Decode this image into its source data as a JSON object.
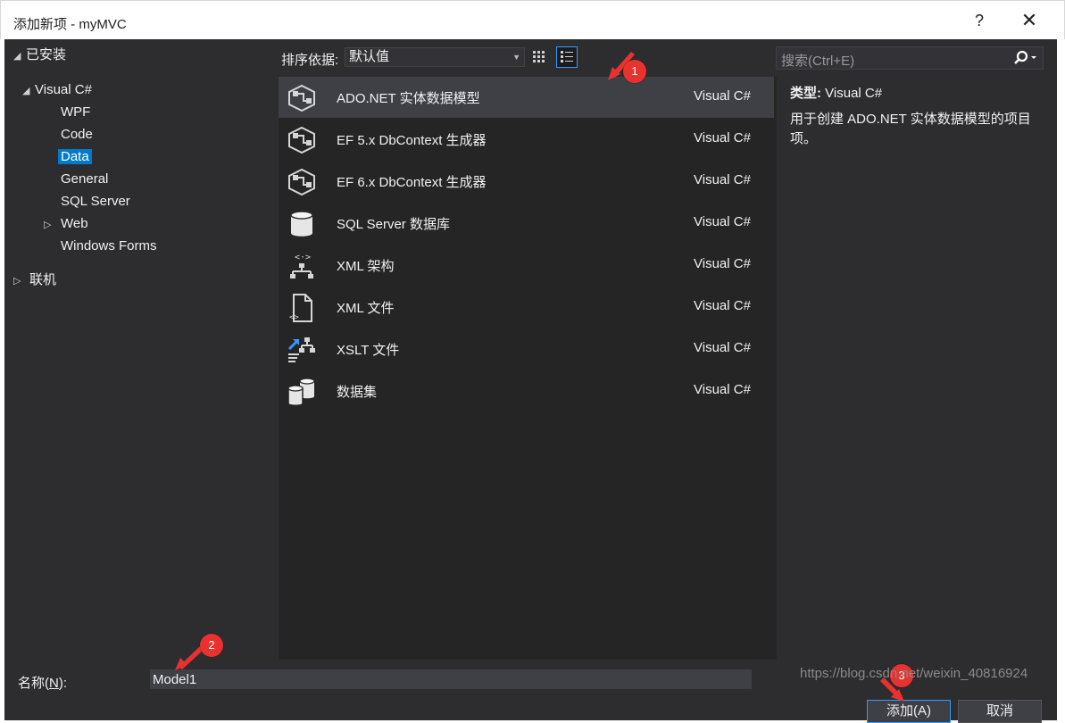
{
  "window": {
    "title": "添加新项 - myMVC",
    "help_label": "?",
    "close_label": "✕"
  },
  "tree": {
    "installed": "已安装",
    "visual_csharp": "Visual C#",
    "children": [
      "WPF",
      "Code",
      "Data",
      "General",
      "SQL Server",
      "Web",
      "Windows Forms"
    ],
    "selected": "Data",
    "online": "联机"
  },
  "toolbar": {
    "sort_label": "排序依据:",
    "sort_value": "默认值"
  },
  "search": {
    "placeholder": "搜索(Ctrl+E)"
  },
  "items": [
    {
      "name": "ADO.NET 实体数据模型",
      "lang": "Visual C#",
      "icon": "ado-net-model-icon"
    },
    {
      "name": "EF 5.x DbContext 生成器",
      "lang": "Visual C#",
      "icon": "ef5-generator-icon"
    },
    {
      "name": "EF 6.x DbContext 生成器",
      "lang": "Visual C#",
      "icon": "ef6-generator-icon"
    },
    {
      "name": "SQL Server 数据库",
      "lang": "Visual C#",
      "icon": "database-icon"
    },
    {
      "name": "XML 架构",
      "lang": "Visual C#",
      "icon": "xml-schema-icon"
    },
    {
      "name": "XML 文件",
      "lang": "Visual C#",
      "icon": "xml-file-icon"
    },
    {
      "name": "XSLT 文件",
      "lang": "Visual C#",
      "icon": "xslt-file-icon"
    },
    {
      "name": "数据集",
      "lang": "Visual C#",
      "icon": "dataset-icon"
    }
  ],
  "details": {
    "type_label": "类型:",
    "type_value": "Visual C#",
    "description": "用于创建 ADO.NET 实体数据模型的项目项。"
  },
  "bottom": {
    "name_label_pre": "名称(",
    "name_label_key": "N",
    "name_label_post": "):",
    "name_value": "Model1",
    "add_label": "添加(A)",
    "cancel_label": "取消"
  },
  "annotations": [
    "1",
    "2",
    "3"
  ],
  "watermark": "https://blog.csdn.net/weixin_40816924",
  "colors": {
    "background": "#2d2d30",
    "list_background": "#252526",
    "selection": "#007acc",
    "badge": "#e8322f"
  }
}
